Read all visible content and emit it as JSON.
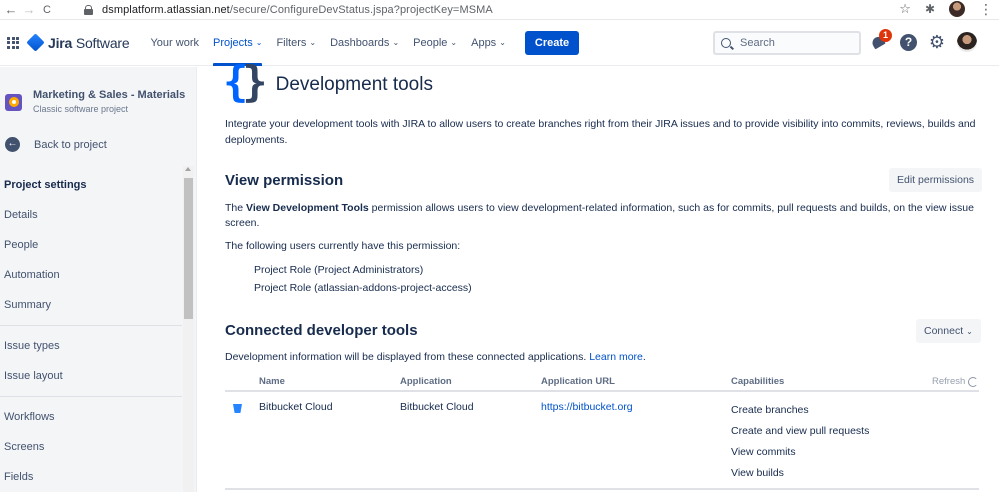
{
  "browser": {
    "url_host": "dsmplatform.atlassian.net",
    "url_path": "/secure/ConfigureDevStatus.jspa?projectKey=MSMA",
    "back_glyph": "←",
    "forward_glyph": "→",
    "reload_glyph": "C",
    "star_glyph": "☆",
    "extension_glyph": "✱",
    "menu_glyph": "⋮"
  },
  "topnav": {
    "brand": "Jira",
    "brand_suffix": "Software",
    "menu": [
      {
        "label": "Your work",
        "has_chevron": false
      },
      {
        "label": "Projects",
        "has_chevron": true
      },
      {
        "label": "Filters",
        "has_chevron": true
      },
      {
        "label": "Dashboards",
        "has_chevron": true
      },
      {
        "label": "People",
        "has_chevron": true
      },
      {
        "label": "Apps",
        "has_chevron": true
      }
    ],
    "chevron": "⌄",
    "create_label": "Create",
    "search_placeholder": "Search",
    "notification_count": "1",
    "help_glyph": "?",
    "settings_glyph": "⚙"
  },
  "sidebar": {
    "project_name": "Marketing & Sales - Materials",
    "project_type": "Classic software project",
    "back_label": "Back to project",
    "back_glyph": "←",
    "settings_heading": "Project settings",
    "group1": [
      "Details",
      "People",
      "Automation",
      "Summary"
    ],
    "group2": [
      "Issue types",
      "Issue layout"
    ],
    "group3": [
      "Workflows",
      "Screens",
      "Fields"
    ]
  },
  "main": {
    "braces_left": "{",
    "braces_right": "}",
    "title": "Development tools",
    "intro": "Integrate your development tools with JIRA to allow users to create branches right from their JIRA issues and to provide visibility into commits, reviews, builds and deployments.",
    "view_permission": {
      "title": "View permission",
      "edit_label": "Edit permissions",
      "text_prefix": "The ",
      "text_bold": "View Development Tools",
      "text_suffix": " permission allows users to view development-related information, such as for commits, pull requests and builds, on the view issue screen.",
      "following": "The following users currently have this permission:",
      "roles": [
        "Project Role (Project Administrators)",
        "Project Role (atlassian-addons-project-access)"
      ]
    },
    "connected": {
      "title": "Connected developer tools",
      "connect_label": "Connect",
      "info_text": "Development information will be displayed from these connected applications.",
      "learn_more": "Learn more",
      "info_end": ".",
      "columns": {
        "name": "Name",
        "application": "Application",
        "url": "Application URL",
        "capabilities": "Capabilities"
      },
      "refresh_label": "Refresh",
      "row": {
        "name": "Bitbucket Cloud",
        "application": "Bitbucket Cloud",
        "url": "https://bitbucket.org",
        "capabilities": [
          "Create branches",
          "Create and view pull requests",
          "View commits",
          "View builds"
        ]
      }
    }
  },
  "colors": {
    "accent": "#0052cc",
    "brand_blue": "#2684ff",
    "badge_red": "#de350b"
  }
}
